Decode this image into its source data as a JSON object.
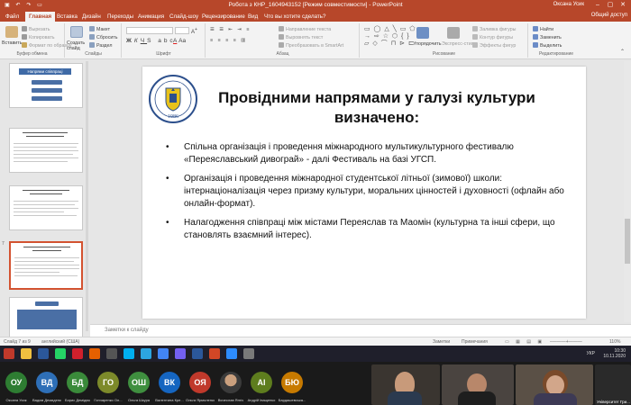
{
  "window": {
    "title": "Робота з КНР_1604943152 [Режим совместимости] - PowerPoint",
    "user": "Оксана Усик",
    "controls": [
      "minimize",
      "restore",
      "close"
    ]
  },
  "tabs": [
    {
      "label": "Файл",
      "active": false
    },
    {
      "label": "Главная",
      "active": true
    },
    {
      "label": "Вставка",
      "active": false
    },
    {
      "label": "Дизайн",
      "active": false
    },
    {
      "label": "Переходы",
      "active": false
    },
    {
      "label": "Анимация",
      "active": false
    },
    {
      "label": "Слайд-шоу",
      "active": false
    },
    {
      "label": "Рецензирование",
      "active": false
    },
    {
      "label": "Вид",
      "active": false
    },
    {
      "label": "Что вы хотите сделать?",
      "active": false
    }
  ],
  "share_label": "Общий доступ",
  "ribbon": {
    "clipboard": {
      "group": "Буфер обмена",
      "paste": "Вставить",
      "cut": "Вырезать",
      "copy": "Копировать",
      "format": "Формат по образцу"
    },
    "slides": {
      "group": "Слайды",
      "new_slide": "Создать слайд",
      "layout": "Макет",
      "reset": "Сбросить",
      "section": "Раздел"
    },
    "font": {
      "group": "Шрифт"
    },
    "paragraph": {
      "group": "Абзац",
      "text_direction": "Направление текста",
      "align_text": "Выровнять текст",
      "smartart": "Преобразовать в SmartArt"
    },
    "drawing": {
      "group": "Рисование",
      "arrange": "Упорядочить",
      "styles": "Экспресс-стили",
      "fill": "Заливка фигуры",
      "outline": "Контур фигуры",
      "effects": "Эффекты фигур"
    },
    "editing": {
      "group": "Редактирование",
      "find": "Найти",
      "replace": "Заменить",
      "select": "Выделить"
    }
  },
  "thumbnails": [
    {
      "number": "",
      "title": "Напрями співпраці",
      "selected": false
    },
    {
      "number": "",
      "title": "",
      "selected": false
    },
    {
      "number": "",
      "title": "",
      "selected": false
    },
    {
      "number": "7",
      "title": "",
      "selected": true
    },
    {
      "number": "",
      "title": "",
      "selected": false
    }
  ],
  "slide": {
    "logo_year": "1986",
    "title": "Провідними напрямами у галузі культури визначено:",
    "bullets": [
      "Спільна організація і проведення міжнародного мультикультурного фестивалю «Переяславський дивограй» - далі Фестиваль на базі УГСП.",
      "Організація і проведення міжнародної студентської літньої (зимової) школи: інтернаціоналізація через призму культури, моральних цінностей і духовності (офлайн або онлайн-формат).",
      "Налагодження співпраці між містами Переяслав та Маомін (культурна та інші сфери, що становлять взаємний інтерес)."
    ]
  },
  "notes_placeholder": "Заметки к слайду",
  "status": {
    "slide_counter": "Слайд 7 из 9",
    "language": "английский (США)",
    "notes_label": "Заметки",
    "comments_label": "Примечания",
    "zoom": "110%"
  },
  "taskbar": {
    "apps": [
      {
        "name": "filezilla-icon",
        "color": "#c0392b"
      },
      {
        "name": "files-icon",
        "color": "#f0c040"
      },
      {
        "name": "word-icon",
        "color": "#2b579a"
      },
      {
        "name": "whatsapp-icon",
        "color": "#25d366"
      },
      {
        "name": "opera-icon",
        "color": "#d0202c"
      },
      {
        "name": "firefox-icon",
        "color": "#e66000"
      },
      {
        "name": "app-icon",
        "color": "#555555"
      },
      {
        "name": "skype-icon",
        "color": "#00aff0"
      },
      {
        "name": "telegram-icon",
        "color": "#2ca5e0"
      },
      {
        "name": "chrome-icon",
        "color": "#4285f4"
      },
      {
        "name": "viber-icon",
        "color": "#7360f2"
      },
      {
        "name": "word2-icon",
        "color": "#2b579a"
      },
      {
        "name": "powerpoint-icon",
        "color": "#d24726"
      },
      {
        "name": "zoom-icon",
        "color": "#2d8cff"
      },
      {
        "name": "app2-icon",
        "color": "#7a7a7a"
      }
    ],
    "language": "УКР",
    "time": "10:30",
    "date": "10.11.2020"
  },
  "participants": [
    {
      "initials": "ОУ",
      "name": "Оксана Усик",
      "color": "#2e7d32"
    },
    {
      "initials": "ВД",
      "name": "Вадим Демиденко",
      "color": "#2e6fb7"
    },
    {
      "initials": "БД",
      "name": "Борис Демідюк",
      "color": "#3a8a3a"
    },
    {
      "initials": "ГО",
      "name": "Гончаренко Ол...",
      "color": "#7d8a2a"
    },
    {
      "initials": "ОШ",
      "name": "Ольга Шкура",
      "color": "#3f8f3f"
    },
    {
      "initials": "ВК",
      "name": "Валентина Кре...",
      "color": "#1565c0"
    },
    {
      "initials": "ОЯ",
      "name": "Ольга Ярмоленко",
      "color": "#c0392b"
    },
    {
      "initials": "",
      "name": "Вячеслав Ягніч",
      "color": "#555555"
    },
    {
      "initials": "АІ",
      "name": "Андрій Іващенко",
      "color": "#5e7d1e"
    },
    {
      "initials": "БЮ",
      "name": "Бардашевська...",
      "color": "#c77a00"
    }
  ],
  "video_tiles": [
    {
      "name": ""
    },
    {
      "name": ""
    },
    {
      "name": ""
    },
    {
      "name": "Університет Гри..."
    }
  ]
}
